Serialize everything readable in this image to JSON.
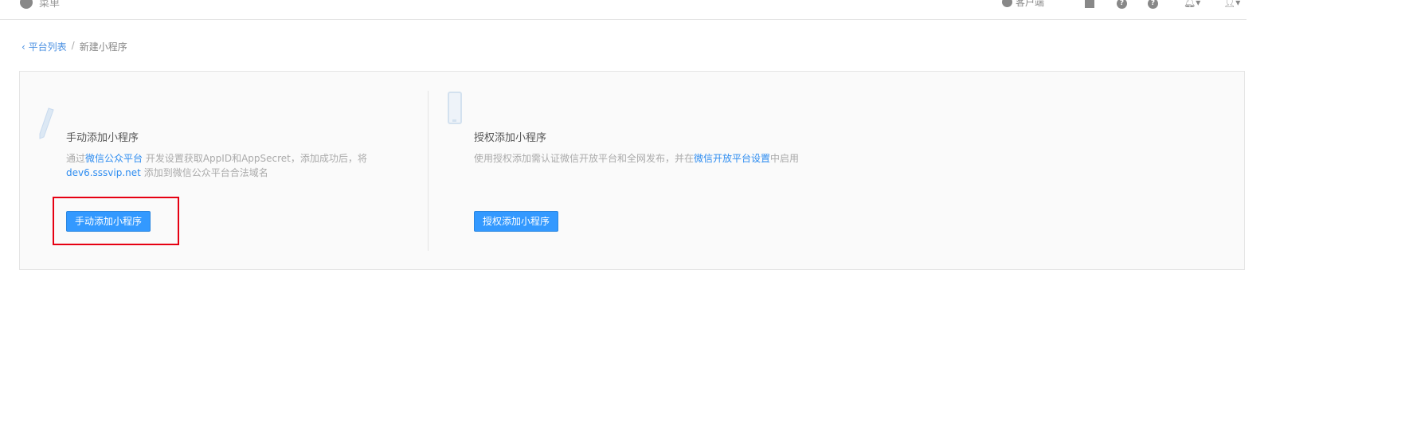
{
  "topbar": {
    "menu_label": "菜单",
    "client_label": "客户端"
  },
  "breadcrumb": {
    "back": "平台列表",
    "separator": "/",
    "current": "新建小程序"
  },
  "manual": {
    "title": "手动添加小程序",
    "desc_prefix": "通过",
    "desc_link": "微信公众平台",
    "desc_mid": " 开发设置获取AppID和AppSecret，添加成功后，将",
    "domain": "dev6.sssvip.net",
    "desc_suffix": " 添加到微信公众平台合法域名",
    "button": "手动添加小程序"
  },
  "auth": {
    "title": "授权添加小程序",
    "desc_prefix": "使用授权添加需认证微信开放平台和全网发布，并在",
    "desc_link": "微信开放平台设置",
    "desc_suffix": "中启用",
    "button": "授权添加小程序"
  },
  "colors": {
    "accent": "#3399ff",
    "highlight": "#e60012"
  }
}
